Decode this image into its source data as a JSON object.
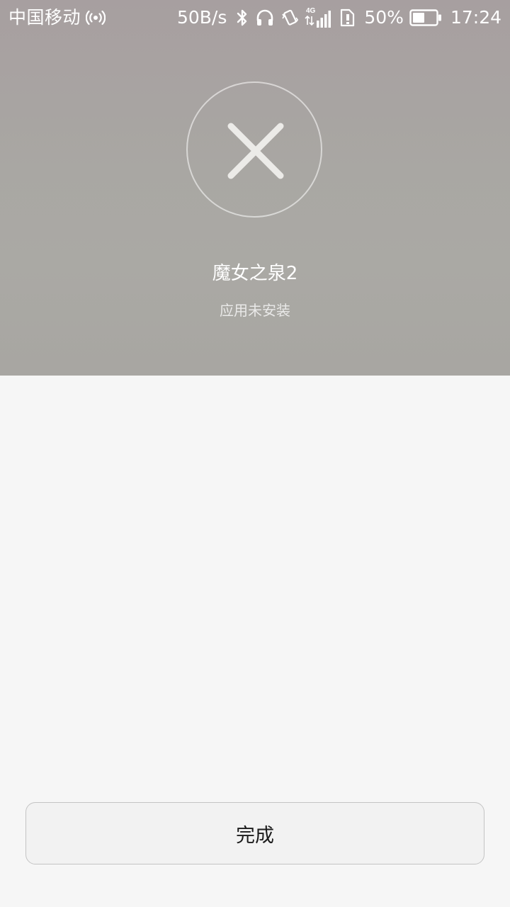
{
  "status_bar": {
    "carrier": "中国移动",
    "net_speed": "50B/s",
    "network_type": "4G",
    "battery_percent": "50%",
    "battery_level": 0.5,
    "time": "17:24",
    "icons": [
      "hotspot-icon",
      "bluetooth-icon",
      "headphones-icon",
      "vibrate-icon",
      "signal-4g-icon",
      "sim-alert-icon",
      "battery-icon"
    ]
  },
  "result": {
    "icon": "close-icon",
    "app_name": "魔女之泉2",
    "status": "应用未安装"
  },
  "actions": {
    "done_label": "完成"
  },
  "colors": {
    "header_bg": "#a9a7a3",
    "page_bg": "#f6f6f6",
    "button_bg": "#f2f2f2",
    "button_border": "#c4c4c4"
  }
}
